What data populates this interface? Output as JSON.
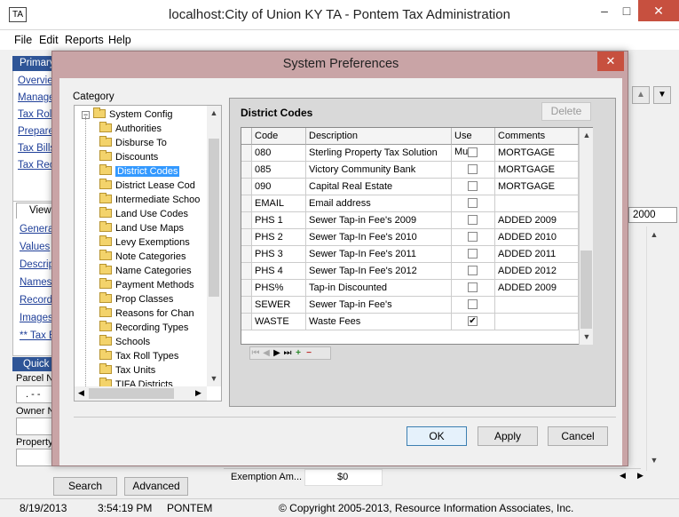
{
  "window": {
    "icon_text": "TA",
    "title": "localhost:City of Union KY  TA - Pontem Tax Administration",
    "minimize": "–",
    "maximize": "□",
    "close": "✕"
  },
  "menu": [
    "File",
    "Edit",
    "Reports",
    "Help"
  ],
  "left_panel": {
    "header": "Primary",
    "links": [
      "Overview",
      "Manage",
      "Tax Roll",
      "Prepare",
      "Tax Bills",
      "Tax Rec"
    ],
    "view_tab": "View",
    "view_links": [
      "General",
      "Values",
      "Descript",
      "Names a",
      "Recordi",
      "Images/",
      "** Tax B"
    ],
    "quick_header": "Quick S",
    "parcel_label": "Parcel Nu",
    "parcel_value": ". - -",
    "owner_label": "Owner N",
    "property_label": "Property",
    "search_button": "Search",
    "advanced_button": "Advanced"
  },
  "behind": {
    "year_value": "2000",
    "exemption_label": "Exemption Am...",
    "exemption_value": "$0"
  },
  "status": {
    "date": "8/19/2013",
    "time": "3:54:19 PM",
    "user": "PONTEM",
    "copyright": "© Copyright 2005-2013, Resource Information Associates, Inc."
  },
  "dialog": {
    "title": "System Preferences",
    "close": "✕",
    "category_label": "Category",
    "tree_root": "System Config",
    "tree_items": [
      "Authorities",
      "Disburse To",
      "Discounts",
      "District Codes",
      "District Lease Cod",
      "Intermediate Schoo",
      "Land Use Codes",
      "Land Use Maps",
      "Levy Exemptions",
      "Note Categories",
      "Name Categories",
      "Payment Methods",
      "Prop Classes",
      "Reasons for Chan",
      "Recording Types",
      "Schools",
      "Tax Roll Types",
      "Tax Units",
      "TIFA Districts"
    ],
    "selected_item": "District Codes",
    "section_title": "District Codes",
    "delete_button": "Delete",
    "columns": [
      "Code",
      "Description",
      "Use Multi",
      "Comments"
    ],
    "rows": [
      {
        "code": "080",
        "description": "Sterling Property Tax Solution",
        "use_multi": "",
        "comments": "MORTGAGE"
      },
      {
        "code": "085",
        "description": "Victory Community Bank",
        "use_multi": "",
        "comments": "MORTGAGE"
      },
      {
        "code": "090",
        "description": "Capital Real Estate",
        "use_multi": "",
        "comments": "MORTGAGE"
      },
      {
        "code": "EMAIL",
        "description": "Email address",
        "use_multi": "",
        "comments": ""
      },
      {
        "code": "PHS 1",
        "description": "Sewer Tap-in Fee's 2009",
        "use_multi": "",
        "comments": "ADDED 2009"
      },
      {
        "code": "PHS 2",
        "description": "Sewer Tap-In Fee's 2010",
        "use_multi": "",
        "comments": "ADDED 2010"
      },
      {
        "code": "PHS 3",
        "description": "Sewer Tap-In Fee's 2011",
        "use_multi": "",
        "comments": "ADDED 2011"
      },
      {
        "code": "PHS 4",
        "description": "Sewer Tap-In Fee's 2012",
        "use_multi": "",
        "comments": "ADDED 2012"
      },
      {
        "code": "PHS%",
        "description": "Tap-in Discounted",
        "use_multi": "",
        "comments": "ADDED 2009"
      },
      {
        "code": "SEWER",
        "description": "Sewer Tap-in Fee's",
        "use_multi": "",
        "comments": ""
      },
      {
        "code": "WASTE",
        "description": "Waste Fees",
        "use_multi": "✔",
        "comments": ""
      }
    ],
    "ok_button": "OK",
    "apply_button": "Apply",
    "cancel_button": "Cancel"
  }
}
